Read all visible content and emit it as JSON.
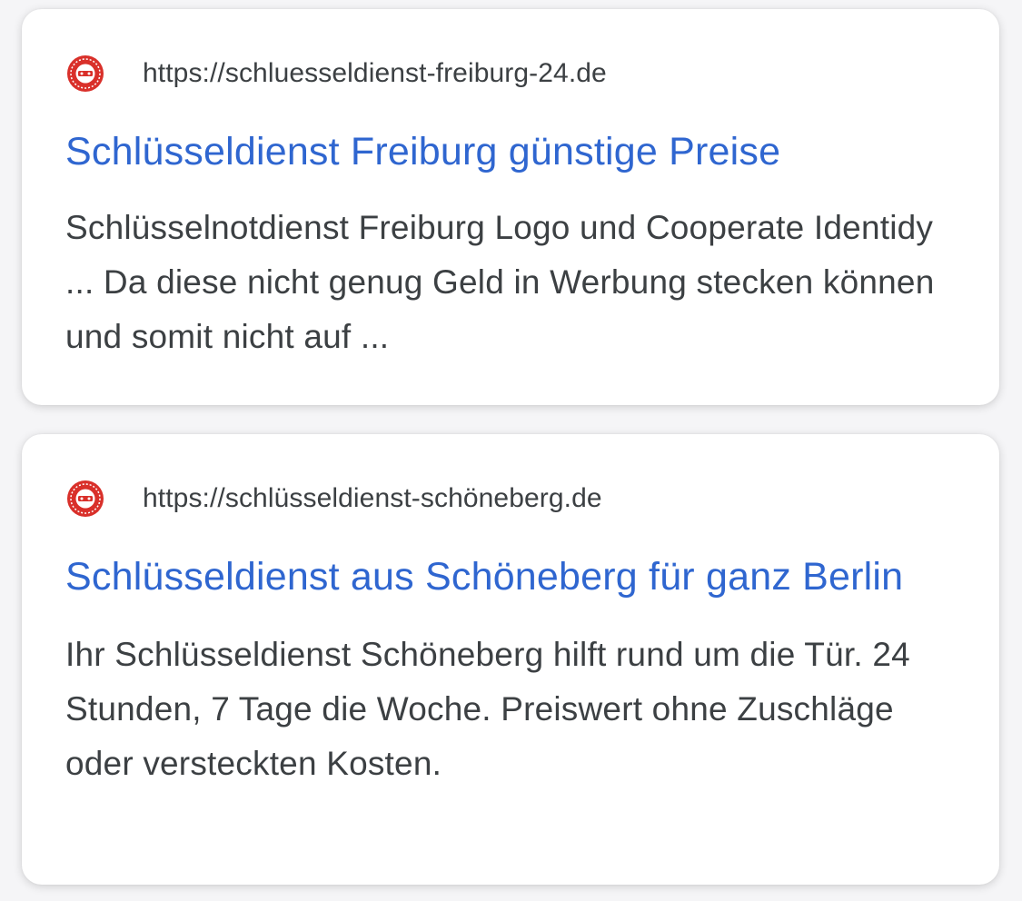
{
  "results": [
    {
      "favicon": "red-circle-logo-icon",
      "url": "https://schluesseldienst-freiburg-24.de",
      "title": "Schlüsseldienst Freiburg günstige Preise",
      "snippet": "Schlüsselnotdienst Freiburg Logo und Cooperate Identidy ... Da diese nicht genug Geld in Werbung stecken können und somit nicht auf ..."
    },
    {
      "favicon": "red-circle-logo-icon",
      "url": "https://schlüsseldienst-schöneberg.de",
      "title": "Schlüsseldienst aus Schöneberg für ganz Berlin",
      "snippet": "Ihr Schlüsseldienst Schöneberg hilft rund um die Tür. 24 Stunden, 7 Tage die Woche. Preiswert ohne Zuschläge oder versteckten Kosten."
    }
  ],
  "colors": {
    "title_link": "#2f66d0",
    "body_text": "#3c4043",
    "favicon_red": "#d9302a",
    "card_background": "#ffffff"
  }
}
